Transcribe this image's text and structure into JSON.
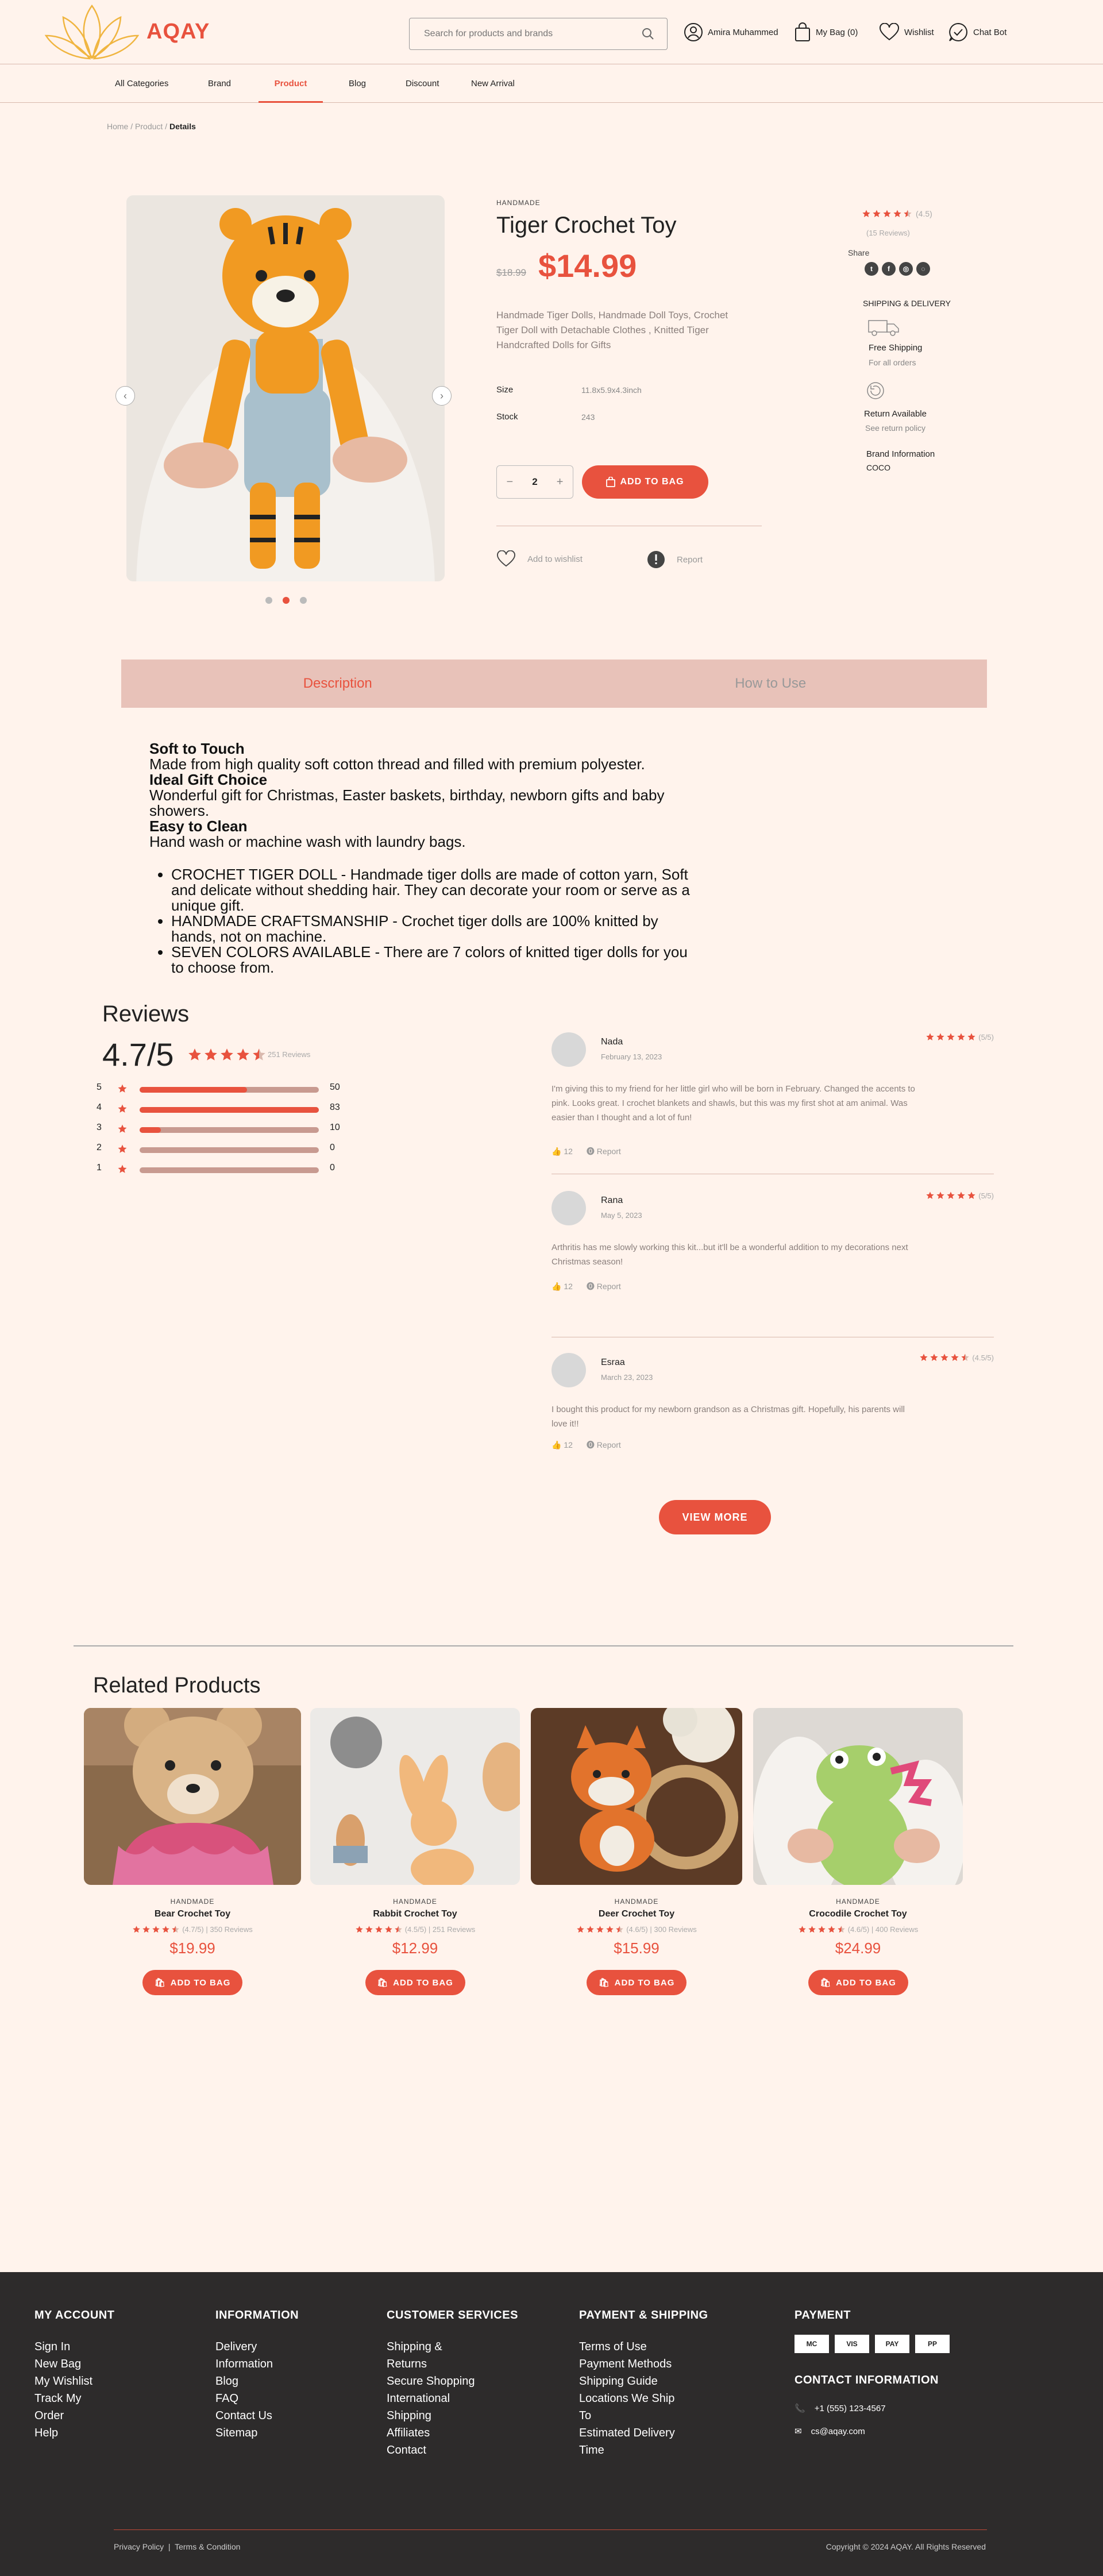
{
  "brand": {
    "name": "AQAY"
  },
  "header": {
    "search_placeholder": "Search for products and brands",
    "user_name": "Amira Muhammed",
    "bag_label": "My Bag (0)",
    "wishlist_label": "Wishlist",
    "chat_label": "Chat Bot"
  },
  "nav": {
    "items": [
      "All Categories",
      "Brand",
      "Product",
      "Blog",
      "Discount",
      "New Arrival"
    ],
    "active": "Product"
  },
  "breadcrumb": {
    "home": "Home",
    "product": "Product",
    "current": "Details"
  },
  "product": {
    "tag": "HANDMADE",
    "title": "Tiger Crochet Toy",
    "old_price": "$18.99",
    "price": "$14.99",
    "description": "Handmade Tiger Dolls, Handmade Doll Toys, Crochet Tiger Doll with Detachable Clothes , Knitted Tiger Handcrafted Dolls for Gifts",
    "size_label": "Size",
    "size_value": "11.8x5.9x4.3inch",
    "stock_label": "Stock",
    "stock_value": "243",
    "quantity": "2",
    "add_to_bag": "ADD TO BAG",
    "wishlist": "Add to wishlist",
    "report": "Report",
    "rating_text": "(4.5)",
    "rating": 4.5,
    "reviews_text": "(15 Reviews)",
    "share_label": "Share",
    "shipping_heading": "SHIPPING & DELIVERY",
    "free_shipping": "Free Shipping",
    "free_shipping_sub": "For all orders",
    "return_available": "Return Available",
    "return_sub": "See return policy",
    "brand_info_label": "Brand Information",
    "brand_info_value": "COCO",
    "gallery_dots": 3,
    "gallery_active": 1
  },
  "tabs": [
    "Description",
    "How to Use"
  ],
  "description": {
    "sections": [
      {
        "heading": "Soft to Touch",
        "text": "Made from high quality soft cotton thread and filled with premium polyester."
      },
      {
        "heading": "Ideal Gift Choice",
        "text": "Wonderful gift for Christmas, Easter baskets, birthday, newborn gifts and baby showers."
      },
      {
        "heading": "Easy to Clean",
        "text": "Hand wash or machine wash with laundry bags."
      }
    ],
    "bullets": [
      "CROCHET TIGER DOLL - Handmade tiger dolls are made of cotton yarn, Soft and delicate without shedding hair. They can decorate your room or serve as a unique gift.",
      "HANDMADE CRAFTSMANSHIP - Crochet tiger dolls are 100% knitted by hands, not on machine.",
      "SEVEN COLORS AVAILABLE - There are 7 colors of knitted tiger dolls for you to choose from."
    ]
  },
  "reviews": {
    "title": "Reviews",
    "average": "4.7/5",
    "count_text": "251 Reviews",
    "distribution": [
      {
        "star": "5",
        "count": "50",
        "fraction": 0.6
      },
      {
        "star": "4",
        "count": "83",
        "fraction": 1.0
      },
      {
        "star": "3",
        "count": "10",
        "fraction": 0.12
      },
      {
        "star": "2",
        "count": "0",
        "fraction": 0
      },
      {
        "star": "1",
        "count": "0",
        "fraction": 0
      }
    ],
    "items": [
      {
        "name": "Nada",
        "date": "February 13, 2023",
        "rating_text": "(5/5)",
        "text": "I'm giving this to my friend for her little girl who will be born in February. Changed the accents to pink. Looks great. I crochet blankets and shawls, but this was my first shot at am animal. Was easier than I thought and a lot of fun!",
        "likes": "12",
        "report": "Report"
      },
      {
        "name": "Rana",
        "date": "May 5, 2023",
        "rating_text": "(5/5)",
        "text": "Arthritis has me slowly working this kit...but it'll be a wonderful addition to my decorations next Christmas season!",
        "likes": "12",
        "report": "Report"
      },
      {
        "name": "Esraa",
        "date": "March 23, 2023",
        "rating_text": "(4.5/5)",
        "text": "I bought this product for my newborn grandson as a Christmas gift. Hopefully, his parents will love it!!",
        "likes": "12",
        "report": "Report"
      }
    ],
    "view_more": "VIEW MORE"
  },
  "related": {
    "title": "Related Products",
    "items": [
      {
        "tag": "HANDMADE",
        "name": "Bear Crochet Toy",
        "rating_text": "(4.7/5) | 350 Reviews",
        "price": "$19.99",
        "button": "ADD TO BAG"
      },
      {
        "tag": "HANDMADE",
        "name": "Rabbit Crochet Toy",
        "rating_text": "(4.5/5) | 251 Reviews",
        "price": "$12.99",
        "button": "ADD TO BAG"
      },
      {
        "tag": "HANDMADE",
        "name": "Deer Crochet Toy",
        "rating_text": "(4.6/5) | 300 Reviews",
        "price": "$15.99",
        "button": "ADD TO BAG"
      },
      {
        "tag": "HANDMADE",
        "name": "Crocodile Crochet Toy",
        "rating_text": "(4.6/5) | 400 Reviews",
        "price": "$24.99",
        "button": "ADD TO BAG"
      }
    ]
  },
  "footer": {
    "account": {
      "title": "MY ACCOUNT",
      "links": [
        "Sign In",
        "New Bag",
        "My Wishlist",
        "Track My",
        "Order",
        "Help"
      ]
    },
    "information": {
      "title": "INFORMATION",
      "links": [
        "Delivery",
        "Information",
        "Blog",
        "FAQ",
        "Contact Us",
        "Sitemap"
      ]
    },
    "customer": {
      "title": "CUSTOMER SERVICES",
      "links": [
        "Shipping &",
        "Returns",
        "Secure Shopping",
        "International",
        "Shipping",
        "Affiliates",
        "Contact"
      ]
    },
    "payship": {
      "title": "PAYMENT & SHIPPING",
      "links": [
        "Terms of Use",
        "Payment Methods",
        "Shipping Guide",
        "Locations We Ship",
        "To",
        "Estimated Delivery",
        "Time"
      ]
    },
    "payment": {
      "title": "PAYMENT",
      "badges": [
        "MC",
        "VIS",
        "PAY",
        "PP"
      ]
    },
    "contact": {
      "title": "CONTACT INFORMATION",
      "phone": "+1 (555) 123-4567",
      "email": "cs@aqay.com"
    },
    "privacy": "Privacy Policy",
    "terms": "Terms & Condition",
    "copyright": "Copyright © 2024 AQAY. All Rights Reserved"
  },
  "colors": {
    "accent": "#e8523e",
    "background": "#fff3ec",
    "tab_bg": "#e8c2b9",
    "footer": "#2d2b2b"
  }
}
